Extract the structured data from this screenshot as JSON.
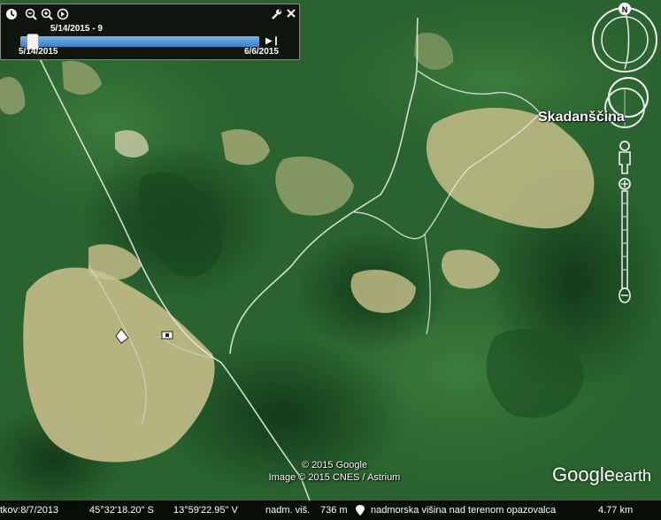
{
  "time_slider": {
    "current_label": "5/14/2015 - 9",
    "start_date": "5/14/2015",
    "end_date": "6/6/2015",
    "position": 0.05
  },
  "map": {
    "place_name": "Skadanščina",
    "copyright_line1": "© 2015 Google",
    "copyright_line2": "Image © 2015 CNES / Astrium",
    "logo_google": "Google",
    "logo_earth": "earth"
  },
  "status": {
    "imagery_date": "tkov:8/7/2013",
    "latitude": "45°32'18.20\" S",
    "longitude": "13°59'22.95\" V",
    "elevation_label": "nadm. viš.",
    "elevation_value": "736 m",
    "eye_alt_label": "nadmorska višina nad terenom opazovalca",
    "eye_alt_value": "4.77 km"
  },
  "compass": {
    "north_label": "N"
  },
  "icons": [
    "clock-icon",
    "zoom-out-icon",
    "zoom-in-icon",
    "time-options-icon",
    "wrench-icon",
    "close-icon",
    "play-icon",
    "compass-icon",
    "look-joystick-icon",
    "move-joystick-icon",
    "street-view-pegman-icon",
    "zoom-slider-icon"
  ],
  "colors": {
    "forest_dark": "#1e5425",
    "forest_mid": "#2f6e33",
    "clearing": "#c7c08a",
    "road": "#e8e8e8",
    "slider_fill": "#3a7ecb",
    "panel_bg": "#0a0a0a"
  }
}
